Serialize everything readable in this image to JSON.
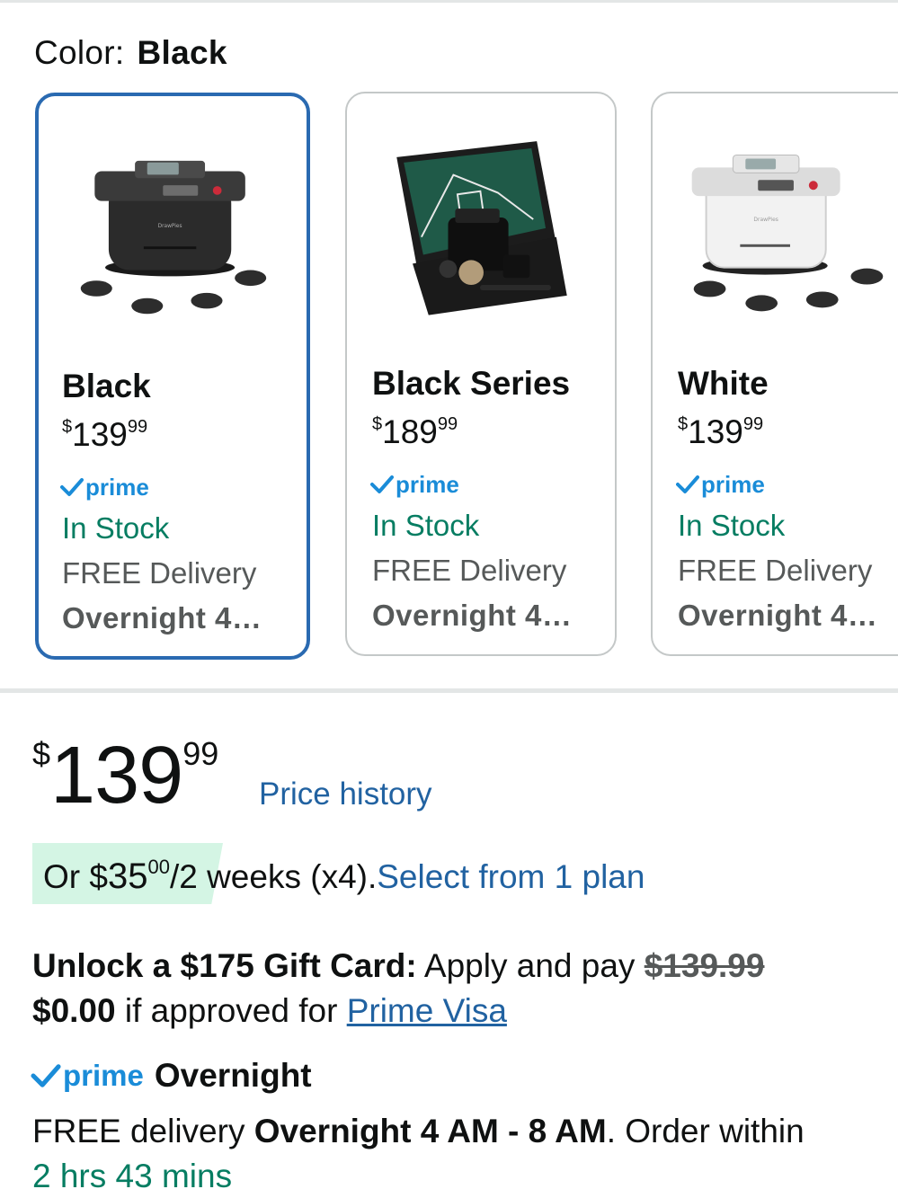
{
  "color_selector": {
    "label": "Color:",
    "value": "Black"
  },
  "variants": [
    {
      "name": "Black",
      "price_whole": "139",
      "price_fraction": "99",
      "currency": "$",
      "prime": "prime",
      "stock": "In Stock",
      "delivery": "FREE Delivery",
      "delivery_time": "Overnight 4…",
      "selected": true
    },
    {
      "name": "Black Series",
      "price_whole": "189",
      "price_fraction": "99",
      "currency": "$",
      "prime": "prime",
      "stock": "In Stock",
      "delivery": "FREE Delivery",
      "delivery_time": "Overnight 4…",
      "selected": false
    },
    {
      "name": "White",
      "price_whole": "139",
      "price_fraction": "99",
      "currency": "$",
      "prime": "prime",
      "stock": "In Stock",
      "delivery": "FREE Delivery",
      "delivery_time": "Overnight 4…",
      "selected": false
    }
  ],
  "main_price": {
    "currency": "$",
    "whole": "139",
    "fraction": "99",
    "history_link": "Price history"
  },
  "installment": {
    "prefix": "Or $",
    "amount": "35",
    "fraction": "00",
    "suffix": "/2 weeks (x4).",
    "link": "Select from 1 plan"
  },
  "gift_card": {
    "bold": "Unlock a $175 Gift Card:",
    "text1": " Apply and pay ",
    "strike_price": "$139.99",
    "new_price": "$0.00",
    "text2": " if approved for ",
    "link": "Prime Visa"
  },
  "prime_delivery": {
    "badge": "prime",
    "label": "Overnight"
  },
  "delivery_info": {
    "prefix": "FREE delivery ",
    "window": "Overnight 4 AM - 8 AM",
    "middle": ". Order within",
    "countdown": "2 hrs 43 mins"
  },
  "colors": {
    "link": "#2162a1",
    "stock_green": "#067d62",
    "prime_blue": "#1a8cd8",
    "selected_border": "#2a6ab1",
    "installment_bg": "#d4f5e4"
  },
  "product_brand_text": "DrawPies"
}
